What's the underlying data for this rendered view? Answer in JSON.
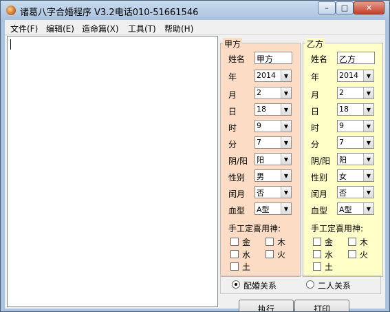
{
  "window": {
    "title": "诸葛八字合婚程序 V3.2电话010-51661546"
  },
  "window_controls": {
    "minimize": "–",
    "maximize": "□",
    "close": "✕"
  },
  "menu": [
    {
      "label": "文件(F)"
    },
    {
      "label": "编辑(E)"
    },
    {
      "label": "造命篇(X)"
    },
    {
      "label": "工具(T)"
    },
    {
      "label": "帮助(H)"
    }
  ],
  "labels": {
    "name": "姓名",
    "year": "年",
    "month": "月",
    "day": "日",
    "hour": "时",
    "minute": "分",
    "yinyang": "阴/阳",
    "gender": "性别",
    "leap": "闰月",
    "blood": "血型",
    "yongshen_title": "手工定喜用神:",
    "elements": [
      "金",
      "木",
      "水",
      "火",
      "土"
    ]
  },
  "person_a": {
    "legend": "甲方",
    "name": "甲方",
    "year": "2014",
    "month": "2",
    "day": "18",
    "hour": "9",
    "minute": "7",
    "yinyang": "阳",
    "gender": "男",
    "leap": "否",
    "blood": "A型",
    "elements_checked": [
      false,
      false,
      false,
      false,
      false
    ]
  },
  "person_b": {
    "legend": "乙方",
    "name": "乙方",
    "year": "2014",
    "month": "2",
    "day": "18",
    "hour": "9",
    "minute": "7",
    "yinyang": "阳",
    "gender": "女",
    "leap": "否",
    "blood": "A型",
    "elements_checked": [
      false,
      false,
      false,
      false,
      false
    ]
  },
  "relationship": {
    "options": [
      "配婚关系",
      "二人关系"
    ],
    "selected": "配婚关系"
  },
  "buttons": {
    "execute": "执行",
    "print": "打印"
  },
  "colors": {
    "panel_a": "#fcdcc4",
    "panel_b": "#ffffc8",
    "titlebar": "#aac3df"
  }
}
